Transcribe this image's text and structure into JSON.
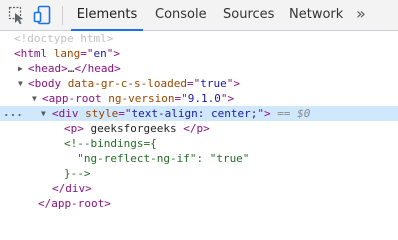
{
  "toolbar": {
    "tabs": [
      "Elements",
      "Console",
      "Sources",
      "Network"
    ],
    "more": "»",
    "inspect_icon": "inspect-element-icon",
    "device_icon": "device-toolbar-icon",
    "active_color": "#1a73e8"
  },
  "dom": {
    "doctype": "<!doctype html>",
    "html_open": "<html",
    "html_attr": " lang",
    "html_eq": "=\"",
    "html_val": "en",
    "html_close": "\">",
    "head": "<head>",
    "head_ellipsis": "…",
    "head_end": "</head>",
    "body_open": "<body",
    "body_attr": " data-gr-c-s-loaded",
    "body_eq": "=\"",
    "body_val": "true",
    "body_close": "\">",
    "app_open": "<app-root",
    "app_attr": " ng-version",
    "app_eq": "=\"",
    "app_val": "9.1.0",
    "app_close": "\">",
    "div_open": "<div",
    "div_attr": " style",
    "div_eq": "=\"",
    "div_val": "text-align: center;",
    "div_close": "\">",
    "div_marker": " == $0",
    "p_open": "<p>",
    "p_text": " geeksforgeeks ",
    "p_close": "</p>",
    "comment_1": "<!--bindings={",
    "comment_2": "  \"ng-reflect-ng-if\": \"true\"",
    "comment_3": "}-->",
    "div_end": "</div>",
    "app_end": "</app-root>",
    "dots": "..."
  }
}
